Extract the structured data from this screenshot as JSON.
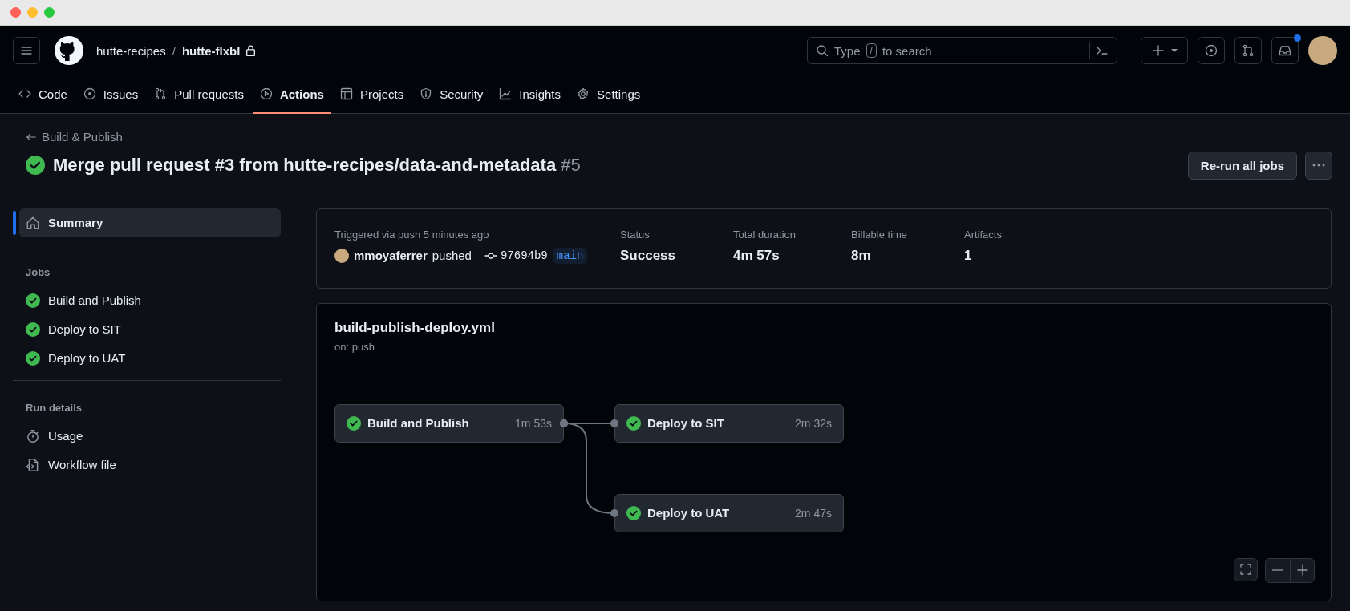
{
  "header": {
    "owner": "hutte-recipes",
    "separator": "/",
    "repo": "hutte-flxbl",
    "private": true,
    "search": {
      "text_before": "Type",
      "key": "/",
      "text_after": "to search"
    },
    "inbox_unread": true
  },
  "tabs": [
    {
      "label": "Code",
      "kind": "code",
      "selected": false
    },
    {
      "label": "Issues",
      "kind": "issues",
      "selected": false
    },
    {
      "label": "Pull requests",
      "kind": "pulls",
      "selected": false
    },
    {
      "label": "Actions",
      "kind": "actions",
      "selected": true
    },
    {
      "label": "Projects",
      "kind": "projects",
      "selected": false
    },
    {
      "label": "Security",
      "kind": "security",
      "selected": false
    },
    {
      "label": "Insights",
      "kind": "insights",
      "selected": false
    },
    {
      "label": "Settings",
      "kind": "settings",
      "selected": false
    }
  ],
  "run": {
    "back_link": "Build & Publish",
    "succeeded": true,
    "title": "Merge pull request #3 from hutte-recipes/data-and-metadata",
    "number": "#5",
    "rerun_button": "Re-run all jobs"
  },
  "sidebar": {
    "summary": {
      "label": "Summary",
      "selected": true
    },
    "sections": [
      {
        "heading": "Jobs",
        "items": [
          {
            "label": "Build and Publish",
            "kind": "job",
            "succeeded": true,
            "selected": false
          },
          {
            "label": "Deploy to SIT",
            "kind": "job",
            "succeeded": true,
            "selected": false
          },
          {
            "label": "Deploy to UAT",
            "kind": "job",
            "succeeded": true,
            "selected": false
          }
        ]
      },
      {
        "heading": "Run details",
        "items": [
          {
            "label": "Usage",
            "kind": "usage",
            "selected": false
          },
          {
            "label": "Workflow file",
            "kind": "workflow",
            "selected": false
          }
        ]
      }
    ]
  },
  "summary": {
    "trigger": "Triggered via push 5 minutes ago",
    "actor": "mmoyaferrer",
    "action": "pushed",
    "commit": "97694b9",
    "branch": "main",
    "stats": [
      {
        "label": "Status",
        "value": "Success"
      },
      {
        "label": "Total duration",
        "value": "4m 57s"
      },
      {
        "label": "Billable time",
        "value": "8m"
      },
      {
        "label": "Artifacts",
        "value": "1"
      }
    ]
  },
  "workflow": {
    "file": "build-publish-deploy.yml",
    "trigger": "on: push",
    "stages": [
      [
        {
          "name": "Build and Publish",
          "duration": "1m 53s",
          "succeeded": true
        }
      ],
      [
        {
          "name": "Deploy to SIT",
          "duration": "2m 32s",
          "succeeded": true
        },
        {
          "name": "Deploy to UAT",
          "duration": "2m 47s",
          "succeeded": true
        }
      ]
    ]
  }
}
